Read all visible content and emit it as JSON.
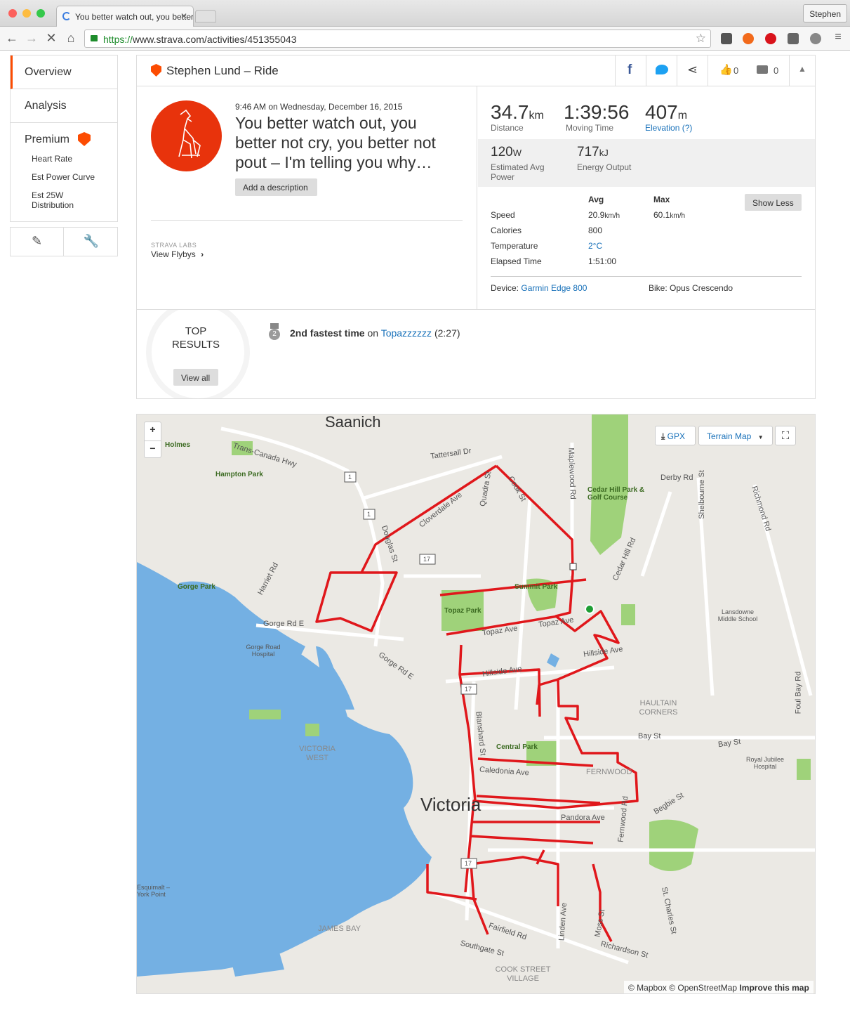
{
  "browser": {
    "tab_title": "You better watch out, you better not cry, you better not pout – I'm telling you why…",
    "profile_name": "Stephen",
    "url_scheme": "https://",
    "url_rest": "www.strava.com/activities/451355043"
  },
  "sidebar": {
    "items": [
      {
        "label": "Overview"
      },
      {
        "label": "Analysis"
      },
      {
        "label": "Premium"
      }
    ],
    "premium_sub": [
      "Heart Rate",
      "Est Power Curve",
      "Est 25W Distribution"
    ]
  },
  "activity": {
    "athlete_title": "Stephen Lund – Ride",
    "kudos_count": "0",
    "comment_count": "0",
    "date": "9:46 AM on Wednesday, December 16, 2015",
    "title": "You better watch out, you better not cry, you better not pout – I'm telling you why…",
    "add_description": "Add a description",
    "labs_label": "STRAVA LABS",
    "flybys_link": "View Flybys"
  },
  "stats": {
    "distance": {
      "value": "34.7",
      "unit": "km",
      "label": "Distance"
    },
    "moving_time": {
      "value": "1:39:56",
      "label": "Moving Time"
    },
    "elevation": {
      "value": "407",
      "unit": "m",
      "label": "Elevation (?)"
    },
    "power": {
      "value": "120",
      "unit": "W",
      "label": "Estimated Avg Power"
    },
    "energy": {
      "value": "717",
      "unit": "kJ",
      "label": "Energy Output"
    },
    "table": {
      "avg_header": "Avg",
      "max_header": "Max",
      "show_less": "Show Less",
      "rows": [
        {
          "label": "Speed",
          "avg": "20.9",
          "avg_unit": "km/h",
          "max": "60.1",
          "max_unit": "km/h"
        },
        {
          "label": "Calories",
          "avg": "800"
        },
        {
          "label": "Temperature",
          "avg": "2°C"
        },
        {
          "label": "Elapsed Time",
          "avg": "1:51:00"
        }
      ]
    },
    "device_label": "Device:",
    "device_value": "Garmin Edge 800",
    "bike": "Bike: Opus Crescendo"
  },
  "top_results": {
    "title": "TOP RESULTS",
    "view_all": "View all",
    "rank": "2",
    "result_bold": "2nd fastest time",
    "result_on": "on",
    "segment": "Topazzzzzz",
    "time": "(2:27)"
  },
  "map": {
    "zoom_in": "+",
    "zoom_out": "−",
    "gpx": "GPX",
    "map_type": "Terrain Map",
    "attribution_1": "© Mapbox © OpenStreetMap",
    "attribution_2": "Improve this map",
    "labels": {
      "saanich": "Saanich",
      "victoria": "Victoria",
      "victoria_west": "VICTORIA WEST",
      "james_bay": "JAMES BAY",
      "cook_village": "COOK STREET VILLAGE",
      "fernwood": "FERNWOOD",
      "haultain": "HAULTAIN CORNERS",
      "trans_canada": "Trans-Canada Hwy",
      "tattersall": "Tattersall Dr",
      "cloverdale": "Cloverdale Ave",
      "douglas": "Douglas St",
      "quadra": "Quadra St",
      "cook": "Cook St",
      "maplewood": "Maplewood Rd",
      "cedar_hill_park": "Cedar Hill Park & Golf Course",
      "cedar_hill_rd": "Cedar Hill Rd",
      "derby": "Derby Rd",
      "shelbourne": "Shelbourne St",
      "richmond": "Richmond Rd",
      "harriet": "Harriet Rd",
      "gorge_park": "Gorge Park",
      "gorge_rd": "Gorge Rd E",
      "gorge_hospital": "Gorge Road Hospital",
      "summit_park": "Summit Park",
      "topaz_park": "Topaz Park",
      "topaz_ave": "Topaz Ave",
      "hillside": "Hillside Ave",
      "lansdowne": "Lansdowne Middle School",
      "central_park": "Central Park",
      "blanshard": "Blanshard St",
      "caledonia": "Caledonia Ave",
      "bay_st": "Bay St",
      "pandora": "Pandora Ave",
      "fernwood_rd": "Fernwood Rd",
      "begbie": "Begbie St",
      "jubilee": "Royal Jubilee Hospital",
      "foul_bay": "Foul Bay Rd",
      "fairfield": "Fairfield Rd",
      "southgate": "Southgate St",
      "linden": "Linden Ave",
      "moss": "Moss St",
      "richardson": "Richardson St",
      "st_charles": "St. Charles St",
      "hampton_park": "Hampton Park",
      "holmes": "Holmes",
      "esquimalt": "Esquimalt – York Point",
      "hwy1": "1",
      "hwy17": "17"
    }
  },
  "colors": {
    "strava_orange": "#fc4c02",
    "route_red": "#e0171b",
    "water": "#74b0e3",
    "park": "#9fd27a",
    "link_blue": "#1770b9"
  }
}
